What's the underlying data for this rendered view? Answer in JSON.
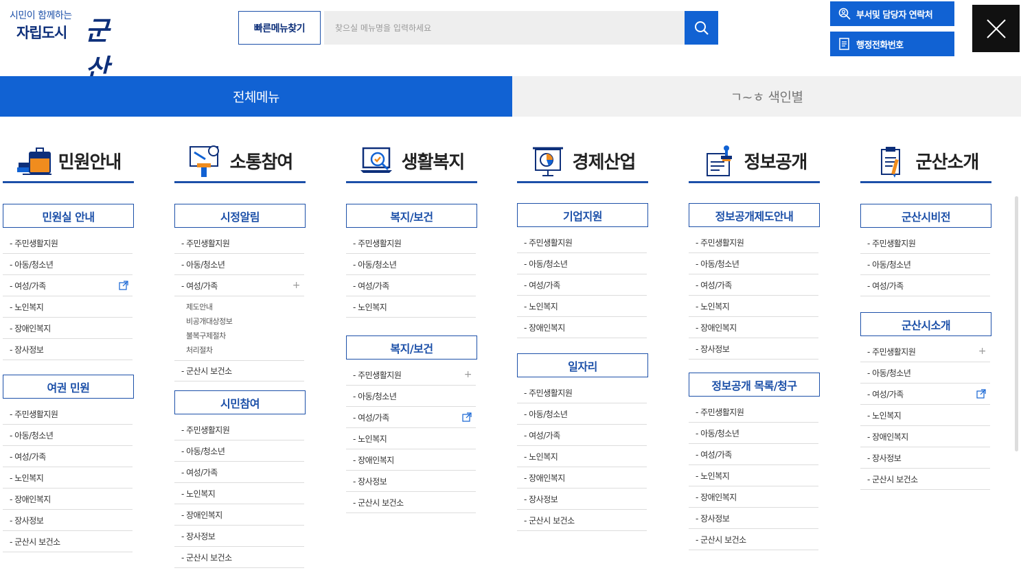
{
  "header": {
    "logo_sub": "시민이 함께하는",
    "logo_main": "자립도시",
    "logo_brand": "군산",
    "quick_menu": "빠른메뉴찾기",
    "search_placeholder": "찾으실 메뉴명을 입력하세요",
    "dept_contact": "부서및 담당자 연락처",
    "admin_phone": "행정전화번호"
  },
  "tabs": {
    "all_menu": "전체메뉴",
    "index": "ㄱ~ㅎ 색인별"
  },
  "colors": {
    "accent": "#1162d3",
    "navy": "#1b4fa8"
  },
  "columns": [
    {
      "title": "민원안내",
      "icon": "briefcase-books-icon",
      "groups": [
        {
          "title": "민원실 안내",
          "items": [
            {
              "label": "- 주민생활지원"
            },
            {
              "label": "- 아동/청소년"
            },
            {
              "label": "- 여성/가족",
              "marker": "external"
            },
            {
              "label": "- 노인복지"
            },
            {
              "label": "- 장애인복지"
            },
            {
              "label": "- 장사정보"
            }
          ]
        },
        {
          "title": "여권 민원",
          "items": [
            {
              "label": "- 주민생활지원"
            },
            {
              "label": "- 아동/청소년"
            },
            {
              "label": "- 여성/가족"
            },
            {
              "label": "- 노인복지"
            },
            {
              "label": "- 장애인복지"
            },
            {
              "label": "- 장사정보"
            },
            {
              "label": "- 군산시 보건소"
            }
          ]
        }
      ]
    },
    {
      "title": "소통참여",
      "icon": "podium-speech-icon",
      "groups": [
        {
          "title": "시정알림",
          "items": [
            {
              "label": "- 주민생활지원"
            },
            {
              "label": "- 아동/청소년"
            },
            {
              "label": "- 여성/가족",
              "marker": "plus"
            },
            {
              "label": "- 군산시 보건소"
            }
          ],
          "subitems": [
            "제도안내",
            "비공개대상정보",
            "불복구제절차",
            "처리절차"
          ]
        },
        {
          "title": "시민참여",
          "items": [
            {
              "label": "- 주민생활지원"
            },
            {
              "label": "- 아동/청소년"
            },
            {
              "label": "- 여성/가족"
            },
            {
              "label": "- 노인복지"
            },
            {
              "label": "- 장애인복지"
            },
            {
              "label": "- 장사정보"
            },
            {
              "label": "- 군산시 보건소"
            }
          ]
        }
      ]
    },
    {
      "title": "생활복지",
      "icon": "laptop-check-icon",
      "groups": [
        {
          "title": "복지/보건",
          "items": [
            {
              "label": "- 주민생활지원"
            },
            {
              "label": "- 아동/청소년"
            },
            {
              "label": "- 여성/가족"
            },
            {
              "label": "- 노인복지"
            }
          ]
        },
        {
          "title": "복지/보건",
          "items": [
            {
              "label": "- 주민생활지원",
              "marker": "plus"
            },
            {
              "label": "- 아동/청소년"
            },
            {
              "label": "- 여성/가족",
              "marker": "external"
            },
            {
              "label": "- 노인복지"
            },
            {
              "label": "- 장애인복지"
            },
            {
              "label": "- 장사정보"
            },
            {
              "label": "- 군산시 보건소"
            }
          ]
        }
      ]
    },
    {
      "title": "경제산업",
      "icon": "presentation-chart-icon",
      "groups": [
        {
          "title": "기업지원",
          "items": [
            {
              "label": "- 주민생활지원"
            },
            {
              "label": "- 아동/청소년"
            },
            {
              "label": "- 여성/가족"
            },
            {
              "label": "- 노인복지"
            },
            {
              "label": "- 장애인복지"
            }
          ]
        },
        {
          "title": "일자리",
          "items": [
            {
              "label": "- 주민생활지원"
            },
            {
              "label": "- 아동/청소년"
            },
            {
              "label": "- 여성/가족"
            },
            {
              "label": "- 노인복지"
            },
            {
              "label": "- 장애인복지"
            },
            {
              "label": "- 장사정보"
            },
            {
              "label": "- 군산시 보건소"
            }
          ]
        }
      ]
    },
    {
      "title": "정보공개",
      "icon": "document-stamp-icon",
      "groups": [
        {
          "title": "정보공개제도안내",
          "items": [
            {
              "label": "- 주민생활지원"
            },
            {
              "label": "- 아동/청소년"
            },
            {
              "label": "- 여성/가족"
            },
            {
              "label": "- 노인복지"
            },
            {
              "label": "- 장애인복지"
            },
            {
              "label": "- 장사정보"
            }
          ]
        },
        {
          "title": "정보공개 목록/청구",
          "items": [
            {
              "label": "- 주민생활지원"
            },
            {
              "label": "- 아동/청소년"
            },
            {
              "label": "- 여성/가족"
            },
            {
              "label": "- 노인복지"
            },
            {
              "label": "- 장애인복지"
            },
            {
              "label": "- 장사정보"
            },
            {
              "label": "- 군산시 보건소"
            }
          ]
        }
      ]
    },
    {
      "title": "군산소개",
      "icon": "clipboard-pen-icon",
      "groups": [
        {
          "title": "군산시비전",
          "items": [
            {
              "label": "- 주민생활지원"
            },
            {
              "label": "- 아동/청소년"
            },
            {
              "label": "- 여성/가족"
            }
          ]
        },
        {
          "title": "군산시소개",
          "items": [
            {
              "label": "- 주민생활지원",
              "marker": "plus"
            },
            {
              "label": "- 아동/청소년"
            },
            {
              "label": "- 여성/가족",
              "marker": "external"
            },
            {
              "label": "- 노인복지"
            },
            {
              "label": "- 장애인복지"
            },
            {
              "label": "- 장사정보"
            },
            {
              "label": "- 군산시 보건소"
            }
          ]
        }
      ]
    }
  ]
}
